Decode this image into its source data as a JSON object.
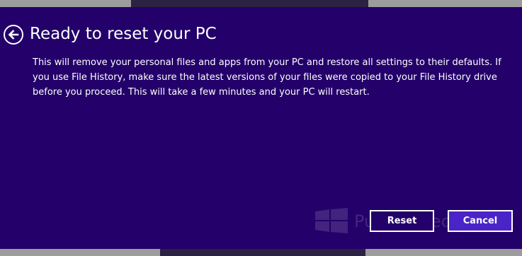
{
  "dialog": {
    "title": "Ready to reset your PC",
    "body": "This will remove your personal files and apps from your PC and restore all settings to their defaults. If you use File History, make sure the latest versions of your files were copied to your File History drive before you proceed. This will take a few minutes and your PC will restart.",
    "back_icon": "back-arrow-icon",
    "reset_label": "Reset",
    "cancel_label": "Cancel"
  },
  "watermark": {
    "text": "Pureinfotech",
    "icon": "windows-logo-icon"
  },
  "colors": {
    "background": "#23006a",
    "cancel_button": "#4b24c8",
    "text": "#ffffff"
  }
}
